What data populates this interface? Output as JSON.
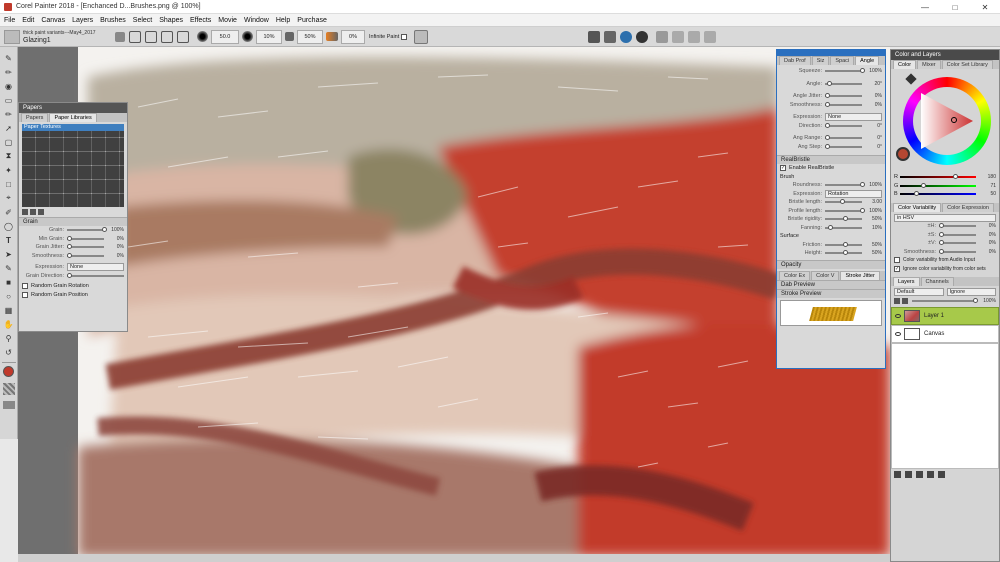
{
  "app": {
    "title": "Corel Painter 2018 - [Enchanced D...Brushes.png @ 100%]"
  },
  "menu": [
    "File",
    "Edit",
    "Canvas",
    "Layers",
    "Brushes",
    "Select",
    "Shapes",
    "Effects",
    "Movie",
    "Window",
    "Help",
    "Purchase"
  ],
  "propbar": {
    "variant_category": "thick paint variants---May4_2017",
    "variant_name": "Glazing1",
    "size": "50.0",
    "opacity": "10%",
    "grain": "50%",
    "resat": "0%",
    "infinite_paint": "Infinite Paint"
  },
  "papers": {
    "title": "Papers",
    "tabs": [
      "Papers",
      "Paper Libraries"
    ],
    "textures_label": "Paper Textures",
    "grain_section": "Grain",
    "rows": [
      {
        "label": "Grain:",
        "value": "100%"
      },
      {
        "label": "Min Grain:",
        "value": "0%"
      },
      {
        "label": "Grain Jitter:",
        "value": "0%"
      },
      {
        "label": "Smoothness:",
        "value": "0%"
      }
    ],
    "expression_label": "Expression:",
    "expression_value": "None",
    "grain_direction": "Grain Direction:",
    "random_rotation": "Random Grain Rotation",
    "random_position": "Random Grain Position"
  },
  "dab": {
    "tabs": [
      "Dab Prof",
      "Siz",
      "Spaci",
      "Angle"
    ],
    "rows": [
      {
        "label": "Squeeze:",
        "value": "100%"
      },
      {
        "label": "Angle:",
        "value": "20°"
      },
      {
        "label": "Angle Jitter:",
        "value": "0%"
      },
      {
        "label": "Smoothness:",
        "value": "0%"
      }
    ],
    "expression_label": "Expression:",
    "expression_value": "None",
    "direction_label": "Direction:",
    "direction_value": "0°",
    "ang_range_label": "Ang Range:",
    "ang_range_value": "0°",
    "ang_step_label": "Ang Step:",
    "ang_step_value": "0°"
  },
  "realbristle": {
    "section": "RealBristle",
    "enable": "Enable RealBristle",
    "brush_label": "Brush",
    "roundness_label": "Roundness:",
    "roundness_value": "100%",
    "expression_label": "Expression:",
    "expression_value": "Rotation",
    "rows": [
      {
        "label": "Bristle length:",
        "value": "3.00"
      },
      {
        "label": "Profile length:",
        "value": "100%"
      },
      {
        "label": "Bristle rigidity:",
        "value": "50%"
      },
      {
        "label": "Fanning:",
        "value": "10%"
      }
    ],
    "surface_label": "Surface",
    "surface_rows": [
      {
        "label": "Friction:",
        "value": "50%"
      },
      {
        "label": "Height:",
        "value": "50%"
      }
    ],
    "opacity_section": "Opacity",
    "lower_tabs": [
      "Color Ex",
      "Color V",
      "Stroke Jitter"
    ],
    "dab_preview": "Dab Preview",
    "stroke_preview": "Stroke Preview"
  },
  "color": {
    "title": "Color and Layers",
    "tabs": [
      "Color",
      "Mixer",
      "Color Set Library"
    ],
    "r_label": "R",
    "r": "180",
    "g_label": "G",
    "g": "71",
    "b_label": "B",
    "b": "50",
    "current": "#b44732"
  },
  "variability": {
    "tabs": [
      "Color Variability",
      "Color Expression"
    ],
    "mode": "in HSV",
    "rows": [
      {
        "label": "±H:",
        "value": "0%"
      },
      {
        "label": "±S:",
        "value": "0%"
      },
      {
        "label": "±V:",
        "value": "0%"
      },
      {
        "label": "Smoothness:",
        "value": "0%"
      }
    ],
    "audio": "Color variability from Audio Input",
    "ignore": "Ignore color variability from color sets"
  },
  "layers": {
    "tabs": [
      "Layers",
      "Channels"
    ],
    "composite": "Default",
    "method": "Ignore",
    "opacity": "100%",
    "items": [
      {
        "name": "Layer 1",
        "selected": true
      },
      {
        "name": "Canvas",
        "selected": false
      }
    ]
  }
}
